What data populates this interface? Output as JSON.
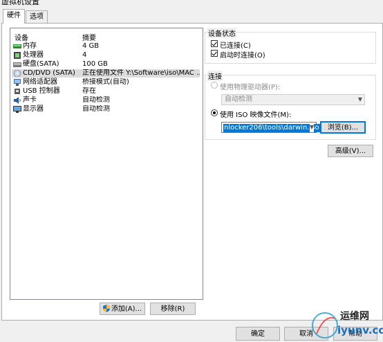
{
  "window": {
    "title": "虚拟机设置"
  },
  "tabs": [
    {
      "label": "硬件"
    },
    {
      "label": "选项"
    }
  ],
  "device_list": {
    "headers": {
      "device": "设备",
      "summary": "摘要"
    },
    "rows": [
      {
        "name": "内存",
        "summary": "4 GB",
        "icon": "memory-icon"
      },
      {
        "name": "处理器",
        "summary": "4",
        "icon": "processor-icon"
      },
      {
        "name": "硬盘(SATA)",
        "summary": "100 GB",
        "icon": "harddisk-icon"
      },
      {
        "name": "CD/DVD (SATA)",
        "summary": "正在使用文件 Y:\\Software\\iso\\MAC ...",
        "icon": "cd-dvd-icon",
        "selected": true
      },
      {
        "name": "网络适配器",
        "summary": "桥接模式(自动)",
        "icon": "network-adapter-icon"
      },
      {
        "name": "USB 控制器",
        "summary": "存在",
        "icon": "usb-icon"
      },
      {
        "name": "声卡",
        "summary": "自动检测",
        "icon": "sound-card-icon"
      },
      {
        "name": "显示器",
        "summary": "自动检测",
        "icon": "display-icon"
      }
    ],
    "add_button": "添加(A)...",
    "remove_button": "移除(R)"
  },
  "device_status": {
    "title": "设备状态",
    "connected": {
      "label": "已连接(C)",
      "checked": true
    },
    "connect_at_power_on": {
      "label": "启动时连接(O)",
      "checked": true
    }
  },
  "connection": {
    "title": "连接",
    "physical_drive": {
      "label": "使用物理驱动器(P):",
      "selected": false,
      "enabled": false
    },
    "physical_drive_value": "自动检测",
    "iso_image": {
      "label": "使用 ISO 映像文件(M):",
      "selected": true
    },
    "iso_path": "nlocker206\\tools\\darwin.iso",
    "browse_button": "浏览(B)..."
  },
  "advanced_button": "高级(V)...",
  "footer": {
    "ok": "确定",
    "cancel": "取消",
    "help": "帮助"
  },
  "watermark": {
    "text": "运维网",
    "url_text": "iyunv.com"
  }
}
